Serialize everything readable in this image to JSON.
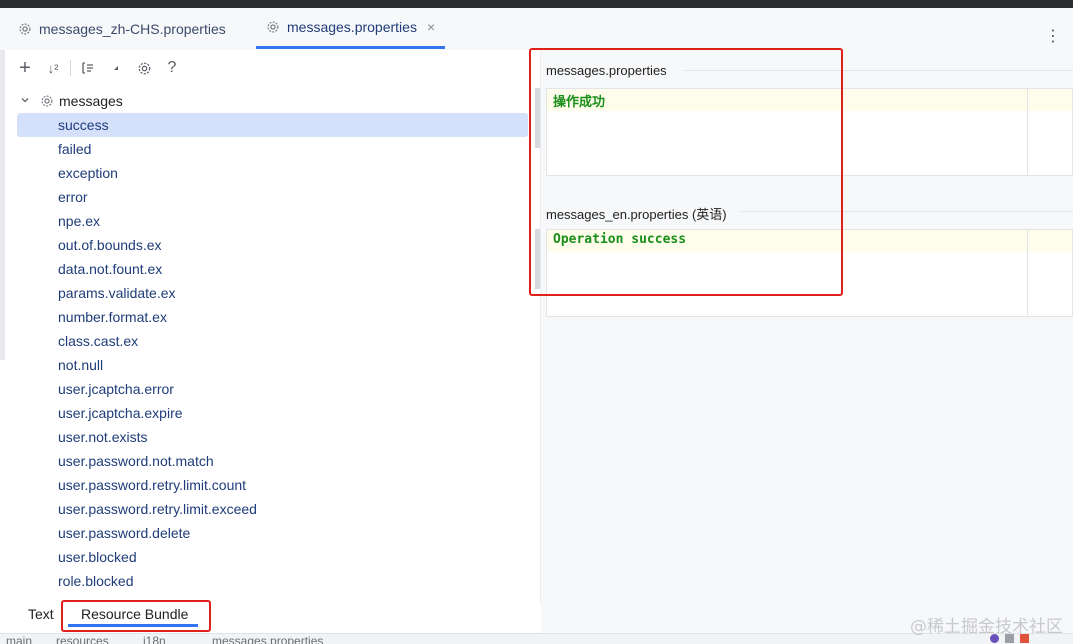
{
  "editor_tabs": [
    {
      "label": "messages_zh-CHS.properties",
      "icon": "gear-icon",
      "active": false
    },
    {
      "label": "messages.properties",
      "icon": "gear-icon",
      "active": true,
      "close": "×"
    }
  ],
  "more_menu": "⋮",
  "toolbar": {
    "add": "+",
    "sort": "↓²",
    "help": "?"
  },
  "tree": {
    "root": "messages",
    "selected": "success",
    "keys": [
      "success",
      "failed",
      "exception",
      "error",
      "npe.ex",
      "out.of.bounds.ex",
      "data.not.fount.ex",
      "params.validate.ex",
      "number.format.ex",
      "class.cast.ex",
      "not.null",
      "user.jcaptcha.error",
      "user.jcaptcha.expire",
      "user.not.exists",
      "user.password.not.match",
      "user.password.retry.limit.count",
      "user.password.retry.limit.exceed",
      "user.password.delete",
      "user.blocked",
      "role.blocked"
    ]
  },
  "bottom_tabs": {
    "text": "Text",
    "resource_bundle": "Resource Bundle"
  },
  "right_panel": {
    "sections": [
      {
        "title": "messages.properties",
        "value": "操作成功"
      },
      {
        "title": "messages_en.properties (英语)",
        "value": "Operation success"
      }
    ]
  },
  "status_bar": {
    "crumb1": "main",
    "crumb2": "resources",
    "crumb3": "i18n",
    "crumb4": "messages.properties"
  },
  "watermark": "@稀土掘金技术社区",
  "colors": {
    "accent": "#3574f0",
    "selection": "#d5e1fb",
    "value_text": "#1a8f1a",
    "annotation_red": "#e0211b"
  }
}
